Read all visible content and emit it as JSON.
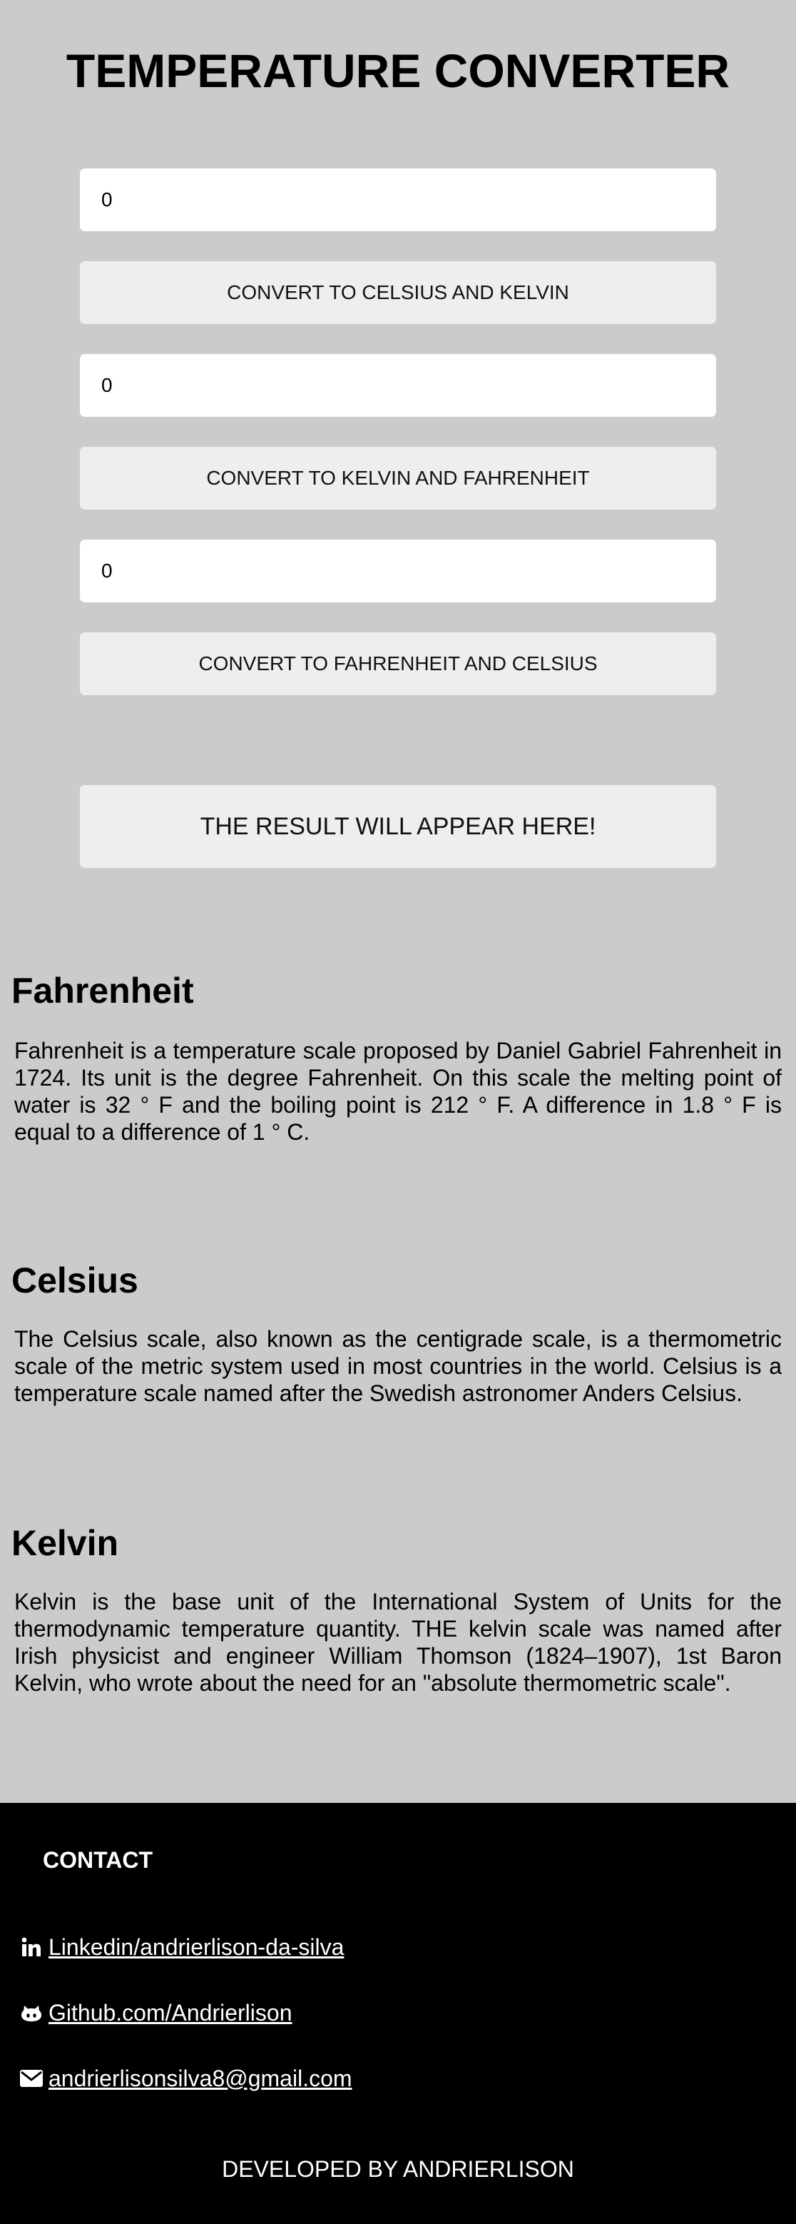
{
  "header": {
    "title": "TEMPERATURE CONVERTER"
  },
  "converter": {
    "fahrenheit_input": {
      "value": "0"
    },
    "to_celsius_kelvin_label": "CONVERT TO CELSIUS AND KELVIN",
    "celsius_input": {
      "value": "0"
    },
    "to_kelvin_fahrenheit_label": "CONVERT TO KELVIN AND FAHRENHEIT",
    "kelvin_input": {
      "value": "0"
    },
    "to_fahrenheit_celsius_label": "CONVERT TO FAHRENHEIT AND CELSIUS",
    "result_text": "THE RESULT WILL APPEAR HERE!"
  },
  "sections": {
    "fahrenheit": {
      "title": "Fahrenheit",
      "text": "Fahrenheit is a temperature scale proposed by Daniel Gabriel Fahrenheit in 1724. Its unit is the degree Fahrenheit. On this scale the melting point of water is 32 ° F and the boiling point is 212 ° F. A difference in 1.8 ° F is equal to a difference of 1 ° C."
    },
    "celsius": {
      "title": "Celsius",
      "text": "The Celsius scale, also known as the centigrade scale, is a thermometric scale of the metric system used in most countries in the world. Celsius is a temperature scale named after the Swedish astronomer Anders Celsius."
    },
    "kelvin": {
      "title": "Kelvin",
      "text": "Kelvin is the base unit of the International System of Units for the thermodynamic temperature quantity. THE kelvin scale was named after Irish physicist and engineer William Thomson (1824–1907), 1st Baron Kelvin, who wrote about the need for an \"absolute thermometric scale\"."
    }
  },
  "footer": {
    "contact_title": "CONTACT",
    "links": [
      {
        "icon": "linkedin-icon",
        "label": "Linkedin/andrierlison-da-silva"
      },
      {
        "icon": "github-icon",
        "label": "Github.com/Andrierlison"
      },
      {
        "icon": "email-icon",
        "label": "andrierlisonsilva8@gmail.com"
      }
    ],
    "credit": "DEVELOPED BY ANDRIERLISON"
  },
  "colors": {
    "page_background": "#cbcbcb",
    "input_background": "#ffffff",
    "button_background": "#eeeeee",
    "footer_background": "#000000",
    "footer_text": "#ffffff"
  }
}
